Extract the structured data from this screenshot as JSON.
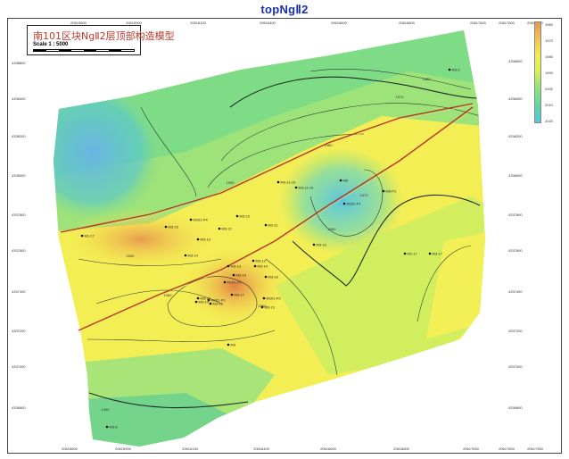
{
  "page": {
    "title": "topNgⅡ2"
  },
  "map": {
    "title": "南101区块NgⅡ2层顶部构造模型",
    "scale": "Scale 1 : 5000"
  },
  "legend": {
    "ticks": [
      "1960",
      "1970",
      "1980",
      "1990",
      "2000",
      "2010",
      "2020"
    ],
    "colors": [
      "#e8964e",
      "#f1c25c",
      "#f5ec50",
      "#d6f05c",
      "#8fe27a",
      "#5fd6a0",
      "#5cc6e0"
    ]
  },
  "axes": {
    "x_ticks_top": [
      "20615800",
      "20615900",
      "20616100",
      "20616400",
      "20616600",
      "20616800",
      "20617600",
      "20617800",
      "20617950"
    ],
    "x_ticks_bottom": [
      "20615800",
      "20615900",
      "20616150",
      "20616400",
      "20616600",
      "20616800",
      "20617650",
      "20617800",
      "20617950"
    ],
    "y_ticks_left": [
      "4338800",
      "4338400",
      "4338200",
      "4338000",
      "4337800",
      "4337600",
      "4337400",
      "4337200",
      "4337000",
      "4336600"
    ],
    "y_ticks_right": [
      "4338600",
      "4338400",
      "4338200",
      "4338000",
      "4337800",
      "4337600",
      "4337400",
      "4337200",
      "4337000",
      "4336800"
    ]
  },
  "contour_labels": [
    "1970",
    "1980",
    "1990",
    "2000",
    "2000",
    "1990",
    "1980",
    "1970",
    "1960",
    "1940"
  ],
  "wells": [
    {
      "name": "M3-2"
    },
    {
      "name": "M5"
    },
    {
      "name": "M3-11-10"
    },
    {
      "name": "M3-11-10"
    },
    {
      "name": "M101-P1"
    },
    {
      "name": "M5-P1"
    },
    {
      "name": "M101-P4"
    },
    {
      "name": "M3-15"
    },
    {
      "name": "M3-11"
    },
    {
      "name": "M3-12"
    },
    {
      "name": "M1-17"
    },
    {
      "name": "M3-15"
    },
    {
      "name": "M3-13"
    },
    {
      "name": "M3-14"
    },
    {
      "name": "M3-16"
    },
    {
      "name": "M3-17"
    },
    {
      "name": "M3-12"
    },
    {
      "name": "M3-13"
    },
    {
      "name": "M3-14"
    },
    {
      "name": "M3-15"
    },
    {
      "name": "M3-16"
    },
    {
      "name": "M101-P3"
    },
    {
      "name": "M3-17"
    },
    {
      "name": "M3-19"
    },
    {
      "name": "M101-P1"
    },
    {
      "name": "M3-14"
    },
    {
      "name": "M101-P2"
    },
    {
      "name": "M3-13"
    },
    {
      "name": "M3-18"
    },
    {
      "name": "M3"
    },
    {
      "name": "M1-17"
    },
    {
      "name": "M3-8"
    }
  ]
}
